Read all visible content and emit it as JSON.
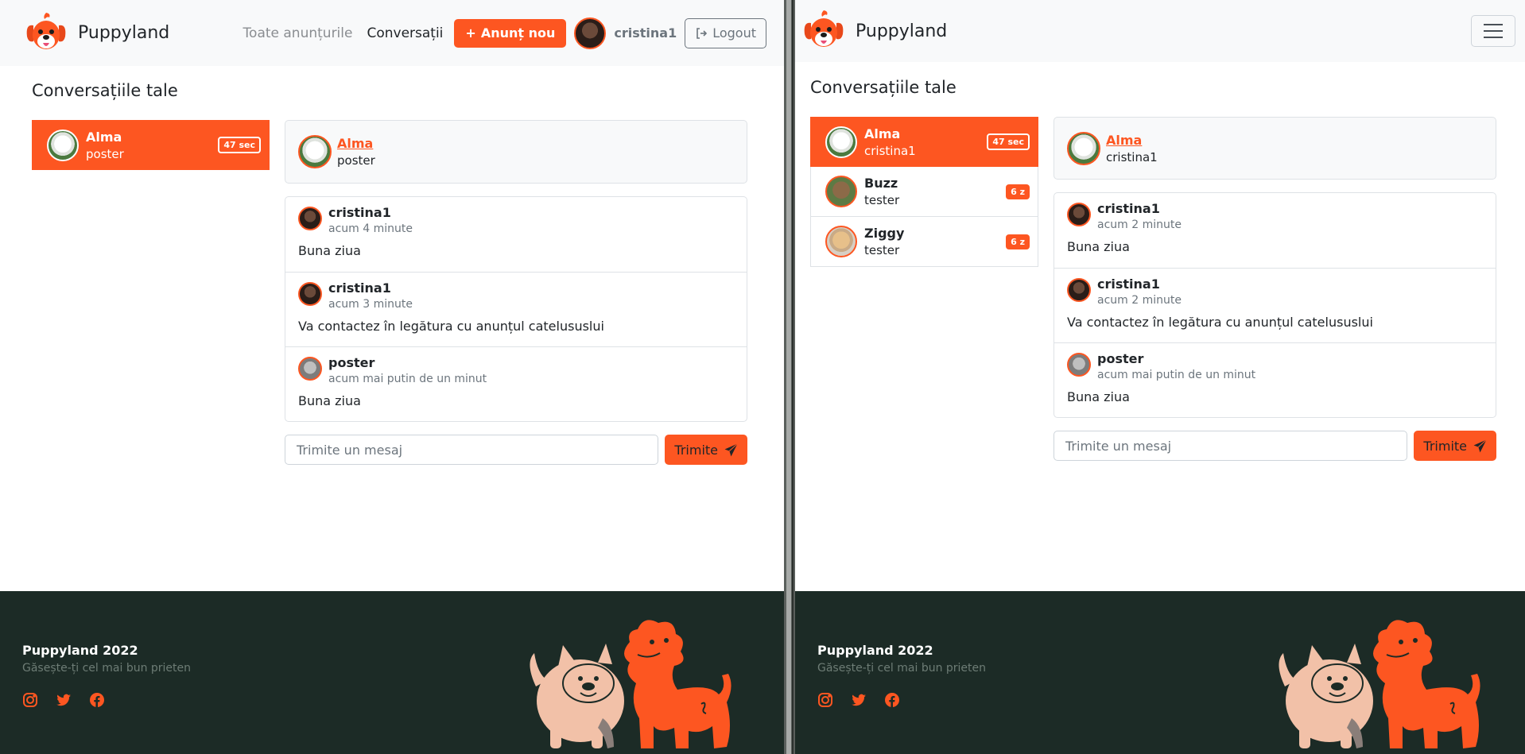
{
  "brand": {
    "name": "Puppyland",
    "accent": "#fd5621"
  },
  "nav": {
    "all_ads": "Toate anunțurile",
    "conversations": "Conversații",
    "new_ad": "Anunț nou",
    "username": "cristina1",
    "logout": "Logout"
  },
  "page_title": "Conversațiile tale",
  "left": {
    "conversations": [
      {
        "name": "Alma",
        "sub": "poster",
        "badge": "47 sec",
        "active": true,
        "avatar": "dog-white"
      }
    ],
    "chat": {
      "name": "Alma",
      "sub": "poster",
      "messages": [
        {
          "author": "cristina1",
          "time": "acum 4 minute",
          "text": "Buna ziua"
        },
        {
          "author": "cristina1",
          "time": "acum 3 minute",
          "text": "Va contactez în legătura cu anunțul catelususlui"
        },
        {
          "author": "poster",
          "time": "acum mai putin de un minut",
          "text": "Buna ziua"
        }
      ]
    }
  },
  "right": {
    "conversations": [
      {
        "name": "Alma",
        "sub": "cristina1",
        "badge": "47 sec",
        "active": true,
        "avatar": "dog-white"
      },
      {
        "name": "Buzz",
        "sub": "tester",
        "badge": "6 z",
        "active": false,
        "avatar": "dog-brown"
      },
      {
        "name": "Ziggy",
        "sub": "tester",
        "badge": "6 z",
        "active": false,
        "avatar": "dog-cream"
      }
    ],
    "chat": {
      "name": "Alma",
      "sub": "cristina1",
      "messages": [
        {
          "author": "cristina1",
          "time": "acum 2 minute",
          "text": "Buna ziua"
        },
        {
          "author": "cristina1",
          "time": "acum 2 minute",
          "text": "Va contactez în legătura cu anunțul catelususlui"
        },
        {
          "author": "poster",
          "time": "acum mai putin de un minut",
          "text": "Buna ziua"
        }
      ]
    }
  },
  "composer": {
    "placeholder": "Trimite un mesaj",
    "send": "Trimite"
  },
  "footer": {
    "title": "Puppyland 2022",
    "tagline": "Găsește-ți cel mai bun prieten",
    "social": [
      "instagram-icon",
      "twitter-icon",
      "facebook-icon"
    ]
  }
}
